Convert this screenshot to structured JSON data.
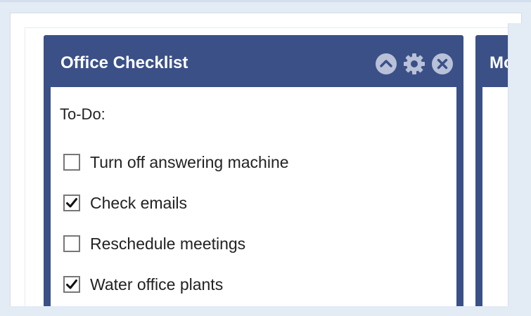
{
  "widget": {
    "title": "Office Checklist",
    "header_icons": [
      "chevron-up-icon",
      "gear-icon",
      "close-icon"
    ],
    "section_label": "To-Do:",
    "items": [
      {
        "label": "Turn off answering machine",
        "checked": false
      },
      {
        "label": "Check emails",
        "checked": true
      },
      {
        "label": "Reschedule meetings",
        "checked": false
      },
      {
        "label": "Water office plants",
        "checked": true
      }
    ]
  },
  "widget2": {
    "title_partial": "Mo"
  },
  "colors": {
    "header_bg": "#3a5087",
    "icon_fill": "#b8c1d8",
    "page_bg": "#e3ebf5"
  }
}
